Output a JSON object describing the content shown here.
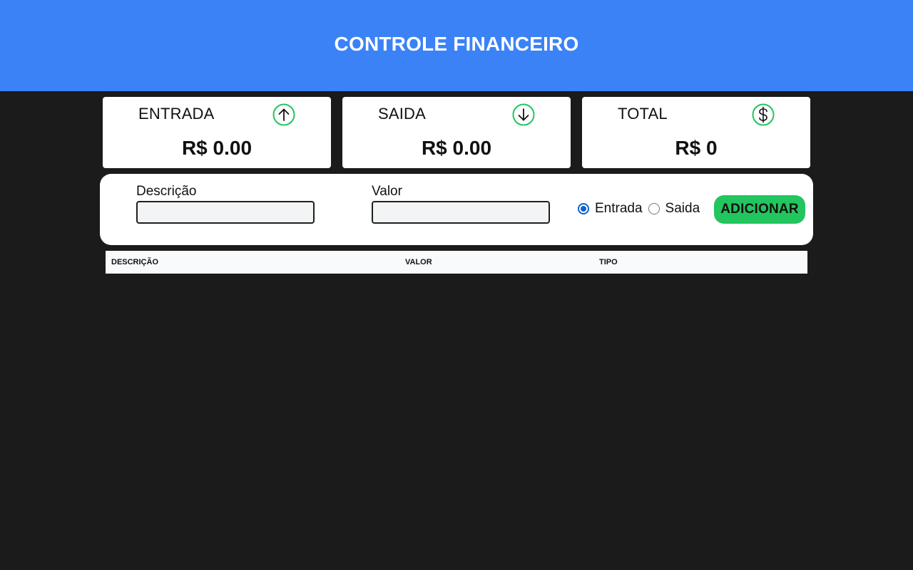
{
  "header": {
    "title": "CONTROLE FINANCEIRO"
  },
  "cards": [
    {
      "title": "ENTRADA",
      "amount": "R$ 0.00",
      "icon": "arrow-up-circle-icon"
    },
    {
      "title": "SAIDA",
      "amount": "R$ 0.00",
      "icon": "arrow-down-circle-icon"
    },
    {
      "title": "TOTAL",
      "amount": "R$ 0",
      "icon": "dollar-circle-icon"
    }
  ],
  "form": {
    "description_label": "Descrição",
    "description_value": "",
    "value_label": "Valor",
    "value_value": "",
    "radio_entrada": "Entrada",
    "radio_saida": "Saida",
    "selected_type": "Entrada",
    "add_button": "ADICIONAR"
  },
  "table": {
    "headers": [
      "DESCRIÇÃO",
      "VALOR",
      "TIPO"
    ],
    "rows": []
  },
  "colors": {
    "header_bg": "#3b82f6",
    "icon_green": "#22c55e",
    "button_green": "#22c55e",
    "page_bg": "#1b1b1b"
  }
}
